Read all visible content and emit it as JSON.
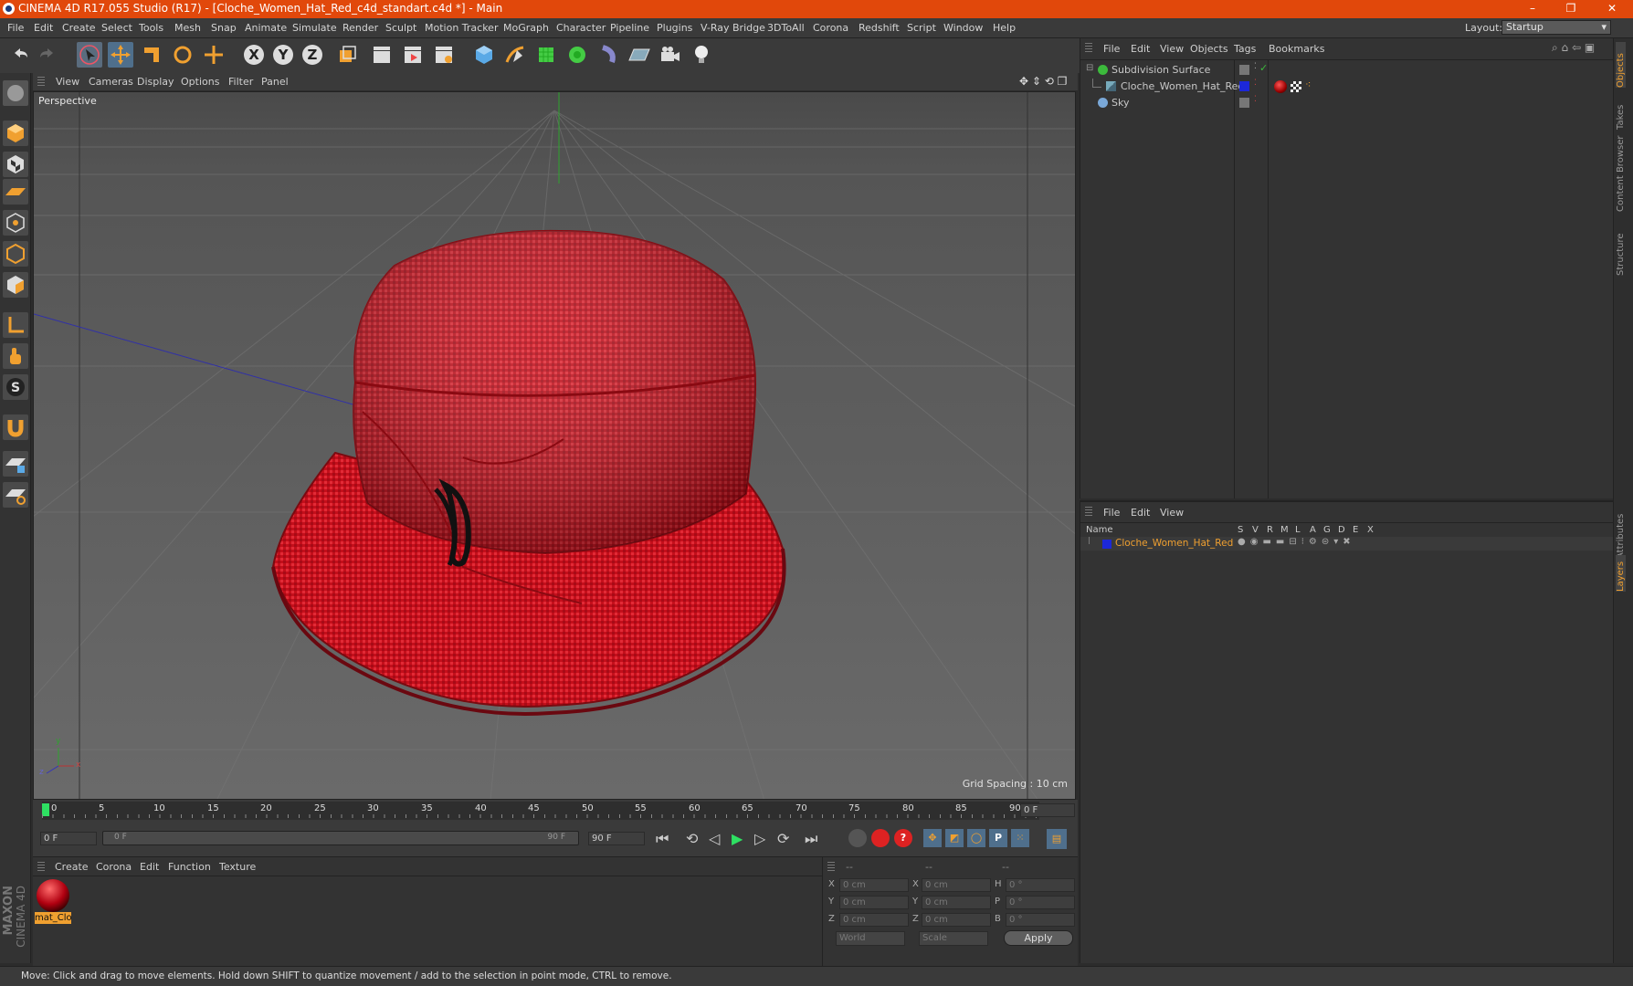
{
  "window": {
    "title": "CINEMA 4D R17.055 Studio (R17) - [Cloche_Women_Hat_Red_c4d_standart.c4d *] - Main",
    "minimize": "–",
    "restore": "❐",
    "close": "✕"
  },
  "menu": {
    "items": [
      "File",
      "Edit",
      "Create",
      "Select",
      "Tools",
      "Mesh",
      "Snap",
      "Animate",
      "Simulate",
      "Render",
      "Sculpt",
      "Motion Tracker",
      "MoGraph",
      "Character",
      "Pipeline",
      "Plugins",
      "V-Ray Bridge",
      "3DToAll",
      "Corona",
      "Redshift",
      "Script",
      "Window",
      "Help"
    ],
    "layout_label": "Layout:",
    "layout_value": "Startup"
  },
  "viewport": {
    "menu": [
      "View",
      "Cameras",
      "Display",
      "Options",
      "Filter",
      "Panel"
    ],
    "label": "Perspective",
    "grid_spacing": "Grid Spacing : 10 cm",
    "axis_y": "y",
    "axis_x": "x",
    "axis_z": "z"
  },
  "timeline": {
    "ticks": [
      "0",
      "5",
      "10",
      "15",
      "20",
      "25",
      "30",
      "35",
      "40",
      "45",
      "50",
      "55",
      "60",
      "65",
      "70",
      "75",
      "80",
      "85",
      "90"
    ],
    "current": "0 F"
  },
  "playback": {
    "start": "0 F",
    "slider_start": "0 F",
    "slider_end": "90 F",
    "end": "90 F"
  },
  "material_panel": {
    "menu": [
      "Create",
      "Corona",
      "Edit",
      "Function",
      "Texture"
    ],
    "material_name": "mat_Clo"
  },
  "coords": {
    "headers": [
      "--",
      "--",
      "--"
    ],
    "rows": [
      {
        "a": "X",
        "av": "0 cm",
        "b": "X",
        "bv": "0 cm",
        "c": "H",
        "cv": "0 °"
      },
      {
        "a": "Y",
        "av": "0 cm",
        "b": "Y",
        "bv": "0 cm",
        "c": "P",
        "cv": "0 °"
      },
      {
        "a": "Z",
        "av": "0 cm",
        "b": "Z",
        "bv": "0 cm",
        "c": "B",
        "cv": "0 °"
      }
    ],
    "world": "World",
    "scale": "Scale",
    "apply": "Apply"
  },
  "objects_panel": {
    "menu": [
      "File",
      "Edit",
      "View",
      "Objects",
      "Tags",
      "Bookmarks"
    ],
    "items": [
      {
        "name": "Subdivision Surface",
        "color": "#c8c8c8"
      },
      {
        "name": "Cloche_Women_Hat_Red",
        "color": "#c8c8c8"
      },
      {
        "name": "Sky",
        "color": "#c8c8c8"
      }
    ]
  },
  "layers_panel": {
    "menu": [
      "File",
      "Edit",
      "View"
    ],
    "col_name": "Name",
    "cols": [
      "S",
      "V",
      "R",
      "M",
      "L",
      "A",
      "G",
      "D",
      "E",
      "X"
    ],
    "layer_name": "Cloche_Women_Hat_Red"
  },
  "right_tabs": [
    "Objects",
    "Takes",
    "Content Browser",
    "Structure",
    "Attributes",
    "Layers"
  ],
  "brand": {
    "maxon": "MAXON",
    "product": "CINEMA 4D"
  },
  "status": "Move: Click and drag to move elements. Hold down SHIFT to quantize movement / add to the selection in point mode, CTRL to remove.",
  "colors": {
    "title_bar": "#e1480b",
    "accent": "#f0a030",
    "hat": "#c8101c",
    "layer_text": "#f0a030"
  }
}
